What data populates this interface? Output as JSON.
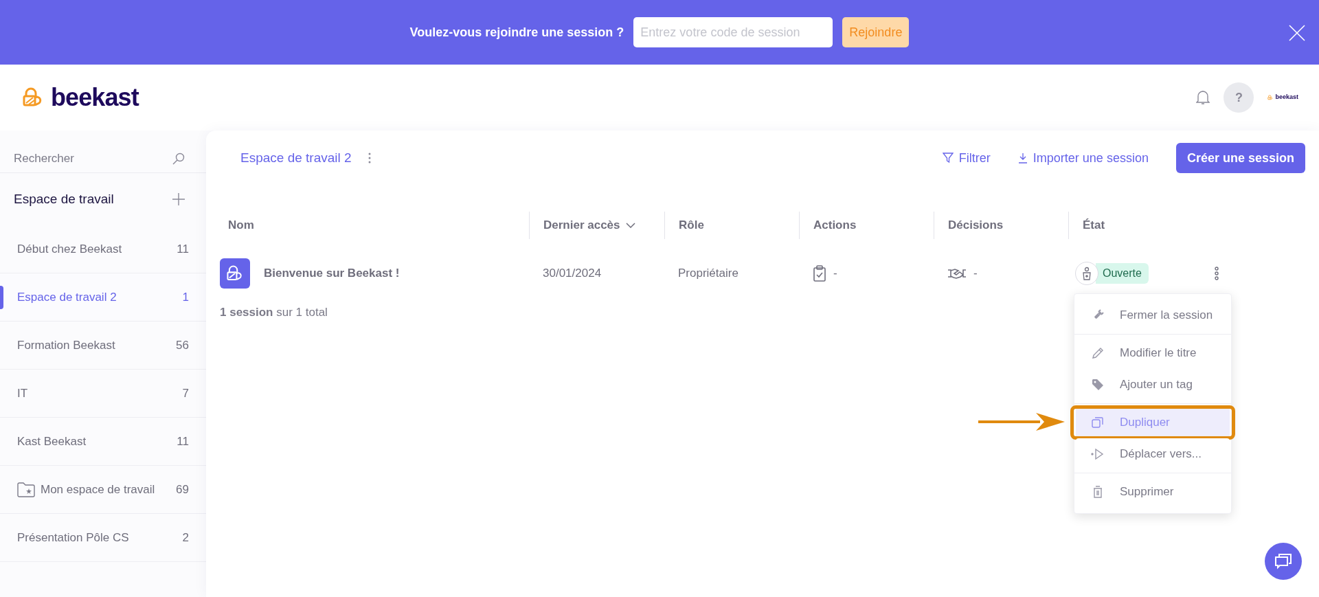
{
  "banner": {
    "prompt": "Voulez-vous rejoindre une session ?",
    "placeholder": "Entrez votre code de session",
    "button": "Rejoindre"
  },
  "header": {
    "logo": "beekast",
    "help": "?",
    "account_logo": "beekast"
  },
  "sidebar": {
    "search_placeholder": "Rechercher",
    "heading": "Espace de travail",
    "items": [
      {
        "kind": "workspace",
        "label": "Début chez Beekast",
        "count": "11",
        "selected": false
      },
      {
        "kind": "workspace",
        "label": "Espace de travail 2",
        "count": "1",
        "selected": true
      },
      {
        "kind": "workspace",
        "label": "Formation Beekast",
        "count": "56",
        "selected": false
      },
      {
        "kind": "workspace",
        "label": "IT",
        "count": "7",
        "selected": false
      },
      {
        "kind": "workspace",
        "label": "Kast Beekast",
        "count": "11",
        "selected": false
      },
      {
        "kind": "personal",
        "label": "Mon espace de travail",
        "count": "69",
        "selected": false
      },
      {
        "kind": "workspace",
        "label": "Présentation Pôle CS",
        "count": "2",
        "selected": false
      }
    ]
  },
  "main": {
    "title": "Espace de travail 2",
    "filter": "Filtrer",
    "import": "Importer une session",
    "create": "Créer une session",
    "table": {
      "columns": [
        {
          "label": "Nom",
          "sorted": false
        },
        {
          "label": "Dernier accès",
          "sorted": true
        },
        {
          "label": "Rôle",
          "sorted": false
        },
        {
          "label": "Actions",
          "sorted": false
        },
        {
          "label": "Décisions",
          "sorted": false
        },
        {
          "label": "État",
          "sorted": false
        }
      ],
      "rows": [
        {
          "name": "Bienvenue sur Beekast !",
          "last_access": "30/01/2024",
          "role": "Propriétaire",
          "actions": "-",
          "decisions": "-",
          "status": "Ouverte"
        }
      ]
    },
    "footer": "**1 session** sur 1 total"
  },
  "context_menu": {
    "groups": [
      [
        {
          "kind": "close",
          "label": "Fermer la session",
          "selected": false,
          "annotated": false
        }
      ],
      [
        {
          "kind": "rename",
          "label": "Modifier le titre",
          "selected": false,
          "annotated": false
        },
        {
          "kind": "tag",
          "label": "Ajouter un tag",
          "selected": false,
          "annotated": false
        }
      ],
      [
        {
          "kind": "duplicate",
          "label": "Dupliquer",
          "selected": true,
          "annotated": true
        },
        {
          "kind": "move",
          "label": "Déplacer vers...",
          "selected": false,
          "annotated": false
        }
      ],
      [
        {
          "kind": "delete",
          "label": "Supprimer",
          "selected": false,
          "annotated": false
        }
      ]
    ]
  }
}
